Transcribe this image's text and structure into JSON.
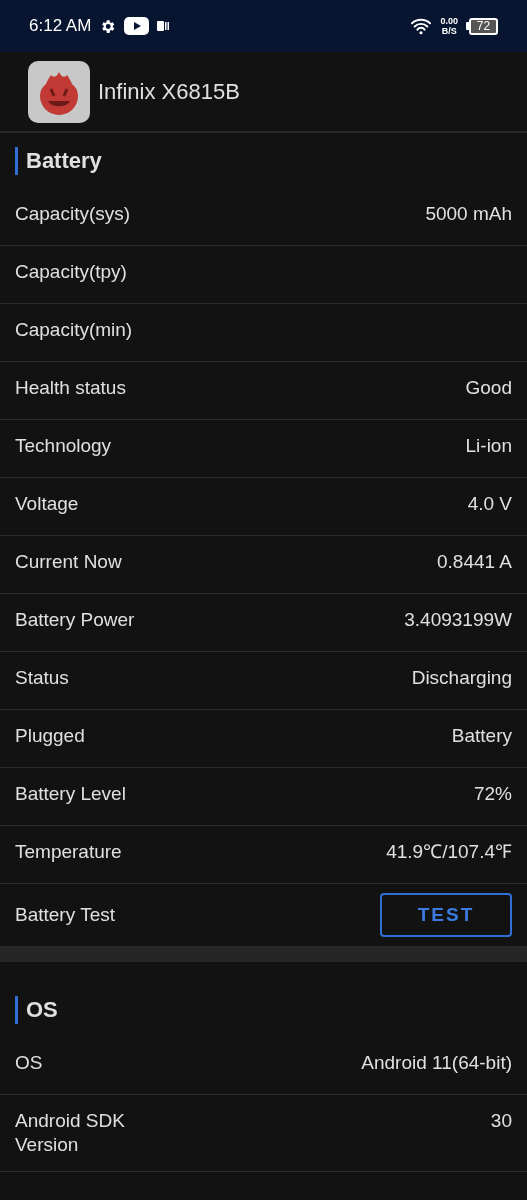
{
  "status_bar": {
    "time": "6:12 AM",
    "net_speed": "0.00",
    "net_unit": "B/S",
    "battery": "72"
  },
  "header": {
    "device": "Infinix X6815B"
  },
  "sections": [
    {
      "title": "Battery",
      "rows": [
        {
          "kind": "value",
          "label": "Capacity(sys)",
          "value": "5000 mAh"
        },
        {
          "kind": "value",
          "label": "Capacity(tpy)"
        },
        {
          "kind": "value",
          "label": "Capacity(min)"
        },
        {
          "kind": "value",
          "label": "Health status",
          "value": "Good"
        },
        {
          "kind": "value",
          "label": "Technology",
          "value": "Li-ion"
        },
        {
          "kind": "value",
          "label": "Voltage",
          "value": "4.0 V"
        },
        {
          "kind": "value",
          "label": "Current Now",
          "value": "0.8441 A"
        },
        {
          "kind": "value",
          "label": "Battery Power",
          "value": "3.4093199W"
        },
        {
          "kind": "value",
          "label": "Status",
          "value": "Discharging"
        },
        {
          "kind": "value",
          "label": "Plugged",
          "value": "Battery"
        },
        {
          "kind": "value",
          "label": "Battery Level",
          "value": "72%"
        },
        {
          "kind": "value",
          "label": "Temperature",
          "value": "41.9℃/107.4℉"
        },
        {
          "kind": "button",
          "label": "Battery Test",
          "value": "TEST"
        }
      ]
    },
    {
      "title": "OS",
      "rows": [
        {
          "kind": "value",
          "label": "OS",
          "value": "Android 11(64-bit)"
        },
        {
          "kind": "value",
          "label": "Android SDK Version",
          "value": "30"
        }
      ]
    }
  ]
}
